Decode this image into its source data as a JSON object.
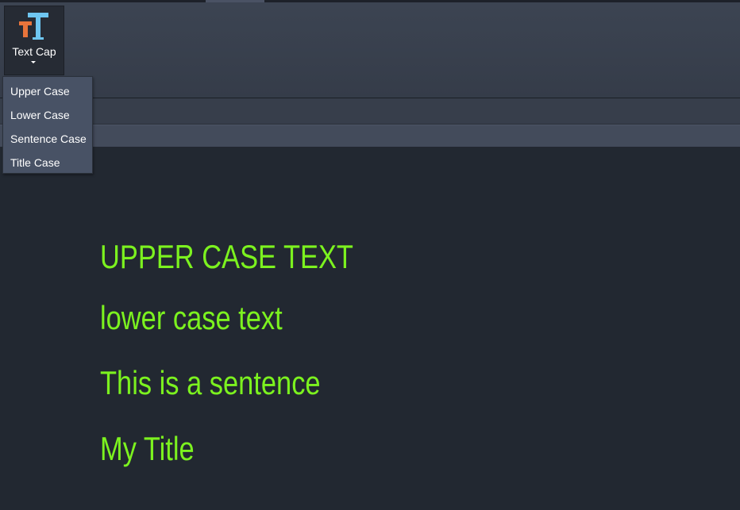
{
  "toolbar": {
    "textcap_button": {
      "label": "Text Cap",
      "icon": "text-case-icon",
      "icon_colors": {
        "small_t": "#e8743b",
        "large_t": "#6ec6f1"
      }
    }
  },
  "dropdown": {
    "items": [
      {
        "label": "Upper Case"
      },
      {
        "label": "Lower Case"
      },
      {
        "label": "Sentence Case"
      },
      {
        "label": "Title Case"
      }
    ]
  },
  "canvas": {
    "text_color": "#7cf21f",
    "lines": [
      "UPPER CASE TEXT",
      "lower case text",
      "This is a sentence",
      "My Title"
    ]
  },
  "theme": {
    "background": "#222831",
    "ribbon": "#3c4452",
    "menu": "#485265"
  }
}
